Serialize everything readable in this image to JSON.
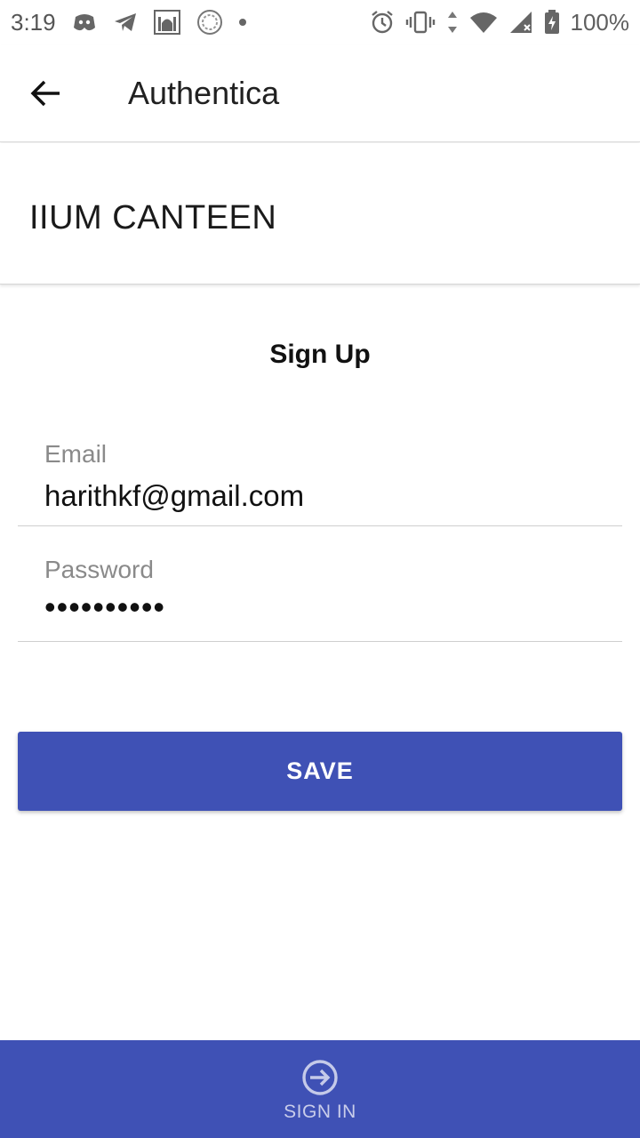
{
  "status_bar": {
    "time": "3:19",
    "battery": "100%",
    "icons": [
      "discord-icon",
      "telegram-icon",
      "mosque-app-icon",
      "circle-app-icon",
      "dot-icon",
      "alarm-icon",
      "vibrate-icon",
      "data-arrows-icon",
      "wifi-icon",
      "cell-signal-icon",
      "battery-icon"
    ]
  },
  "app_bar": {
    "title": "Authentica",
    "back_icon": "arrow-back-icon"
  },
  "header": {
    "text": "IIUM CANTEEN"
  },
  "form": {
    "title": "Sign Up",
    "email": {
      "label": "Email",
      "value": "harithkf@gmail.com"
    },
    "password": {
      "label": "Password",
      "value": "••••••••••"
    },
    "save_label": "SAVE"
  },
  "bottom_nav": {
    "item": {
      "label": "SIGN IN",
      "icon": "sign-in-icon"
    }
  },
  "colors": {
    "primary": "#3f51b5",
    "nav_text": "#c5cae9"
  }
}
